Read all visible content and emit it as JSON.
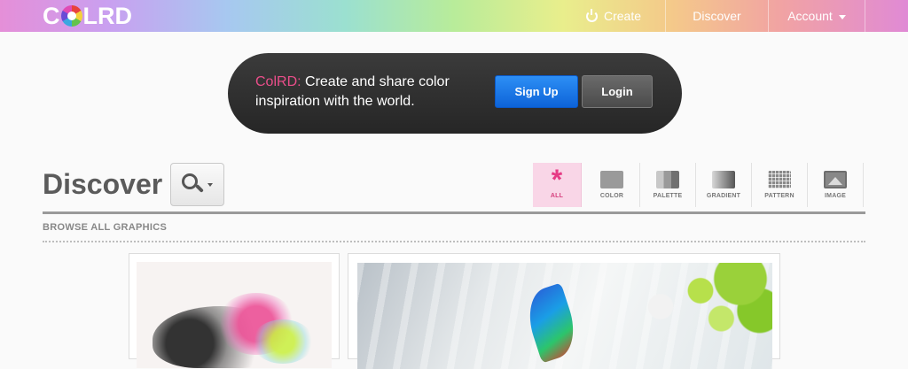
{
  "app": {
    "logo_text_left": "C",
    "logo_text_right": "LRD"
  },
  "nav": {
    "create_label": "Create",
    "discover_label": "Discover",
    "account_label": "Account"
  },
  "banner": {
    "brand": "ColRD:",
    "message": "Create and share color inspiration with the world.",
    "signup_label": "Sign Up",
    "login_label": "Login"
  },
  "main": {
    "title": "Discover",
    "browse_label": "BROWSE ALL GRAPHICS"
  },
  "filters": [
    {
      "label": "ALL",
      "icon": "asterisk-icon",
      "active": true
    },
    {
      "label": "COLOR",
      "icon": "color-swatch-icon"
    },
    {
      "label": "PALETTE",
      "icon": "palette-icon"
    },
    {
      "label": "GRADIENT",
      "icon": "gradient-icon"
    },
    {
      "label": "PATTERN",
      "icon": "pattern-icon"
    },
    {
      "label": "IMAGE",
      "icon": "image-icon"
    }
  ],
  "colors": {
    "brand_pink": "#ea4e8a",
    "signup_blue": "#0d63d8",
    "active_filter_bg": "#f9d6e7"
  }
}
